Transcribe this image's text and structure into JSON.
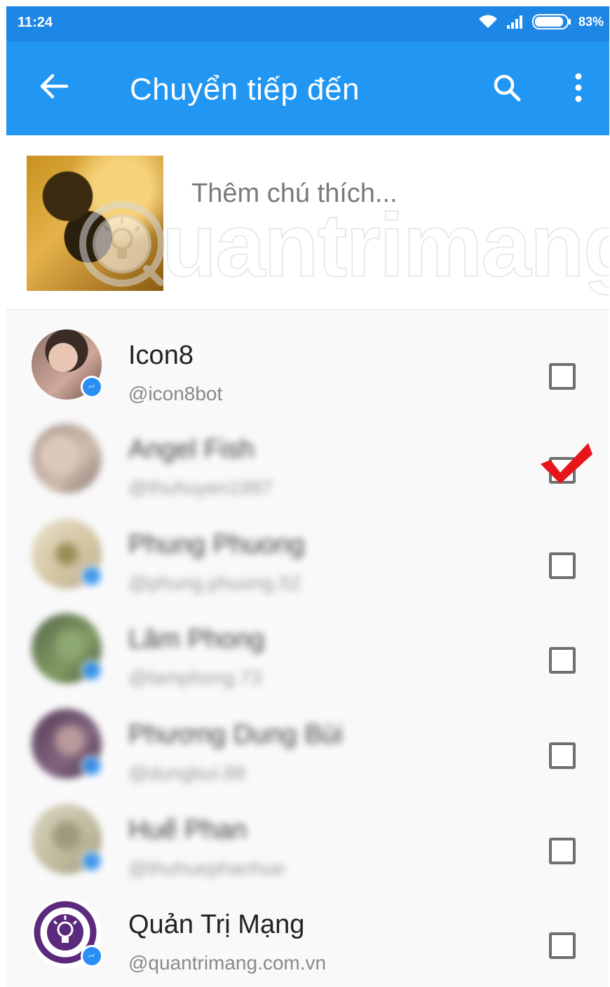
{
  "status_bar": {
    "time": "11:24",
    "battery": "83%"
  },
  "app_bar": {
    "title": "Chuyển tiếp đến",
    "back_icon": "arrow-back-icon",
    "search_icon": "search-icon",
    "more_icon": "more-vertical-icon"
  },
  "caption": {
    "placeholder": "Thêm chú thích..."
  },
  "watermark": {
    "text": "uantrimang"
  },
  "contacts": [
    {
      "name": "Icon8",
      "handle": "@icon8bot",
      "checked": false,
      "blurred": false
    },
    {
      "name": "Angel Fish",
      "handle": "@thuhuyen1997",
      "checked": true,
      "blurred": true
    },
    {
      "name": "Phung Phuong",
      "handle": "@phung.phuong.52",
      "checked": false,
      "blurred": true
    },
    {
      "name": "Lâm Phong",
      "handle": "@lamphong.73",
      "checked": false,
      "blurred": true
    },
    {
      "name": "Phương Dung Bùi",
      "handle": "@dungbui.88",
      "checked": false,
      "blurred": true
    },
    {
      "name": "Huế Phan",
      "handle": "@thuhuephanhue",
      "checked": false,
      "blurred": true
    },
    {
      "name": "Quản Trị Mạng",
      "handle": "@quantrimang.com.vn",
      "checked": false,
      "blurred": false
    }
  ],
  "colors": {
    "status_bar": "#1e86e4",
    "app_bar": "#2196f3",
    "messenger_badge": "#2a8ff5",
    "checkmark": "#e8141b"
  }
}
